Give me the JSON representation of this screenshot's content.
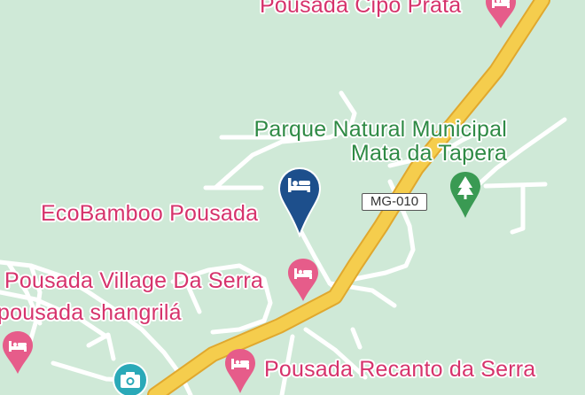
{
  "colors": {
    "background": "#cfe9d7",
    "hotel_pin": "#e65c8a",
    "hotel_label": "#d6336c",
    "selected_pin": "#1d4f8c",
    "park_label": "#2f8a45",
    "highway_fill": "#f5cd4d",
    "highway_casing": "#e0a82e",
    "minor_road": "#ffffff",
    "camera_marker": "#2aa9b8"
  },
  "places": {
    "hotel_top": "Pousada Cipo Prata",
    "ecobamboo": "EcoBamboo Pousada",
    "village": "Pousada Village Da Serra",
    "shangrila": "pousada shangrilá",
    "recanto": "Pousada Recanto da Serra"
  },
  "park": {
    "line1": "Parque Natural Municipal",
    "line2": "Mata da Tapera"
  },
  "road_shield": "MG-010",
  "icons": {
    "hotel_marker": "bed-icon",
    "selected_marker": "bed-icon",
    "park_marker": "tree-icon",
    "attraction_marker": "camera-icon"
  }
}
